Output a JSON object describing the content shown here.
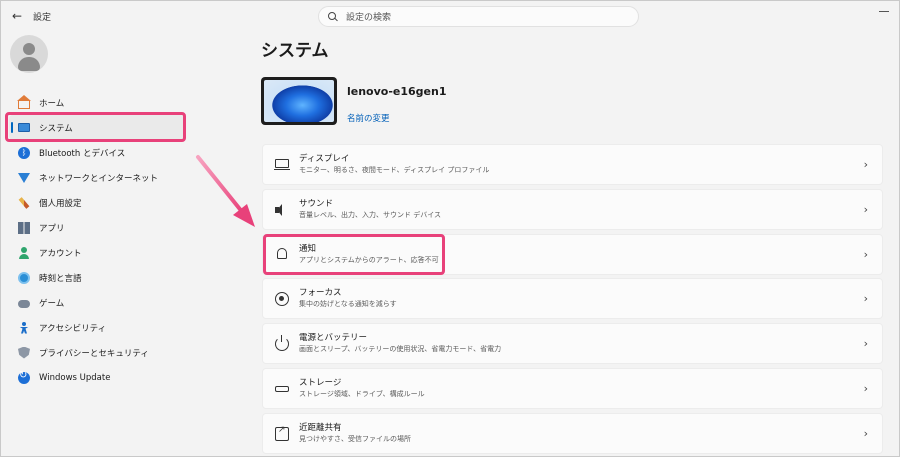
{
  "window": {
    "back_glyph": "←",
    "title": "設定",
    "search_placeholder": "設定の検索"
  },
  "sidebar": {
    "items": [
      {
        "label": "ホーム",
        "icon": "home-icon"
      },
      {
        "label": "システム",
        "icon": "system-icon",
        "active": true
      },
      {
        "label": "Bluetooth とデバイス",
        "icon": "bluetooth-icon"
      },
      {
        "label": "ネットワークとインターネット",
        "icon": "network-icon"
      },
      {
        "label": "個人用設定",
        "icon": "personalization-icon"
      },
      {
        "label": "アプリ",
        "icon": "apps-icon"
      },
      {
        "label": "アカウント",
        "icon": "account-icon"
      },
      {
        "label": "時刻と言語",
        "icon": "time-language-icon"
      },
      {
        "label": "ゲーム",
        "icon": "gaming-icon"
      },
      {
        "label": "アクセシビリティ",
        "icon": "accessibility-icon"
      },
      {
        "label": "プライバシーとセキュリティ",
        "icon": "privacy-icon"
      },
      {
        "label": "Windows Update",
        "icon": "windows-update-icon"
      }
    ]
  },
  "main": {
    "title": "システム",
    "device_name": "lenovo-e16gen1",
    "rename_link": "名前の変更",
    "cards": [
      {
        "title": "ディスプレイ",
        "desc": "モニター、明るさ、夜間モード、ディスプレイ プロファイル",
        "icon": "display-icon"
      },
      {
        "title": "サウンド",
        "desc": "音量レベル、出力、入力、サウンド デバイス",
        "icon": "sound-icon"
      },
      {
        "title": "通知",
        "desc": "アプリとシステムからのアラート、応答不可",
        "icon": "bell-icon"
      },
      {
        "title": "フォーカス",
        "desc": "集中の妨げとなる通知を減らす",
        "icon": "focus-icon"
      },
      {
        "title": "電源とバッテリー",
        "desc": "画面とスリープ、バッテリーの使用状況、省電力モード、省電力",
        "icon": "power-icon"
      },
      {
        "title": "ストレージ",
        "desc": "ストレージ領域、ドライブ、構成ルール",
        "icon": "storage-icon"
      },
      {
        "title": "近距離共有",
        "desc": "見つけやすさ、受信ファイルの場所",
        "icon": "nearby-share-icon"
      }
    ],
    "chevron": "›"
  },
  "colors": {
    "accent": "#0067c0",
    "annotation": "#e8417a",
    "link": "#005fb8"
  }
}
